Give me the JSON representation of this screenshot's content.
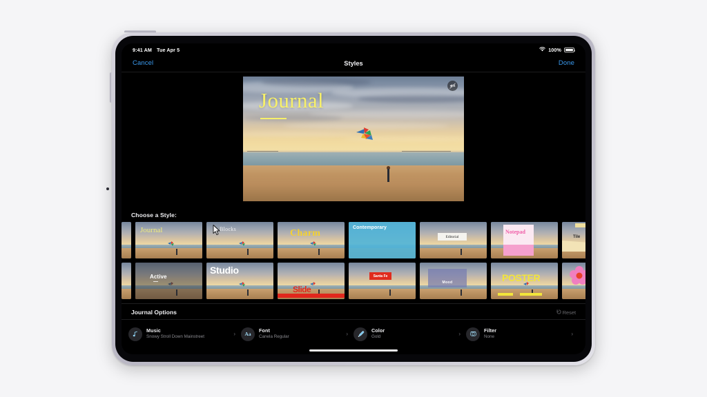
{
  "device": {
    "name": "iPad Air",
    "frame_color": "#c8c6d1"
  },
  "status_bar": {
    "time": "9:41 AM",
    "date": "Tue Apr 5",
    "wifi_icon": "wifi-icon",
    "battery_percent": "100%",
    "battery_icon": "battery-full-icon"
  },
  "nav_bar": {
    "cancel_label": "Cancel",
    "title": "Styles",
    "done_label": "Done"
  },
  "preview": {
    "title_text": "Journal",
    "title_color": "#f7f06a",
    "mute_icon": "speaker-muted-icon",
    "scene": "beach-sunset-with-kite"
  },
  "choose_style": {
    "label": "Choose a Style:",
    "row1": [
      {
        "name": "partial-left-1",
        "label": "",
        "selected": false,
        "partial": true
      },
      {
        "name": "journal",
        "label": "Journal",
        "selected": true,
        "partial": false
      },
      {
        "name": "blocks",
        "label": "Blocks",
        "selected": false,
        "partial": false
      },
      {
        "name": "charm",
        "label": "Charm",
        "selected": false,
        "partial": false
      },
      {
        "name": "contemporary",
        "label": "Contemporary",
        "selected": false,
        "partial": false
      },
      {
        "name": "editorial",
        "label": "Editorial",
        "selected": false,
        "partial": false
      },
      {
        "name": "notepad",
        "label": "Notepad",
        "selected": false,
        "partial": false
      },
      {
        "name": "tile",
        "label": "Tile",
        "selected": false,
        "partial": true
      }
    ],
    "row2": [
      {
        "name": "partial-left-2",
        "label": "",
        "selected": false,
        "partial": true
      },
      {
        "name": "active",
        "label": "Active",
        "selected": false,
        "partial": false
      },
      {
        "name": "studio",
        "label": "Studio",
        "selected": false,
        "partial": false
      },
      {
        "name": "slide",
        "label": "Slide",
        "selected": false,
        "partial": false
      },
      {
        "name": "santa-fe",
        "label": "Santa Fe",
        "selected": false,
        "partial": false
      },
      {
        "name": "mood",
        "label": "Mood",
        "selected": false,
        "partial": false
      },
      {
        "name": "poster",
        "label": "POSTER",
        "selected": false,
        "partial": false
      },
      {
        "name": "bloom",
        "label": "Bloom",
        "selected": false,
        "partial": true
      }
    ]
  },
  "options": {
    "header_title": "Journal Options",
    "reset_label": "Reset",
    "reset_icon": "reset-arrow-icon",
    "items": [
      {
        "name": "music",
        "icon": "music-note-icon",
        "title": "Music",
        "value": "Snowy Stroll Down Mainstreet",
        "chevron": "›"
      },
      {
        "name": "font",
        "icon": "font-aa-icon",
        "title": "Font",
        "value": "Canela Regular",
        "chevron": "›"
      },
      {
        "name": "color",
        "icon": "eyedropper-icon",
        "title": "Color",
        "value": "Gold",
        "chevron": "›"
      },
      {
        "name": "filter",
        "icon": "filter-icon",
        "title": "Filter",
        "value": "None",
        "chevron": "›"
      }
    ]
  },
  "home_indicator": {
    "visible": true
  }
}
